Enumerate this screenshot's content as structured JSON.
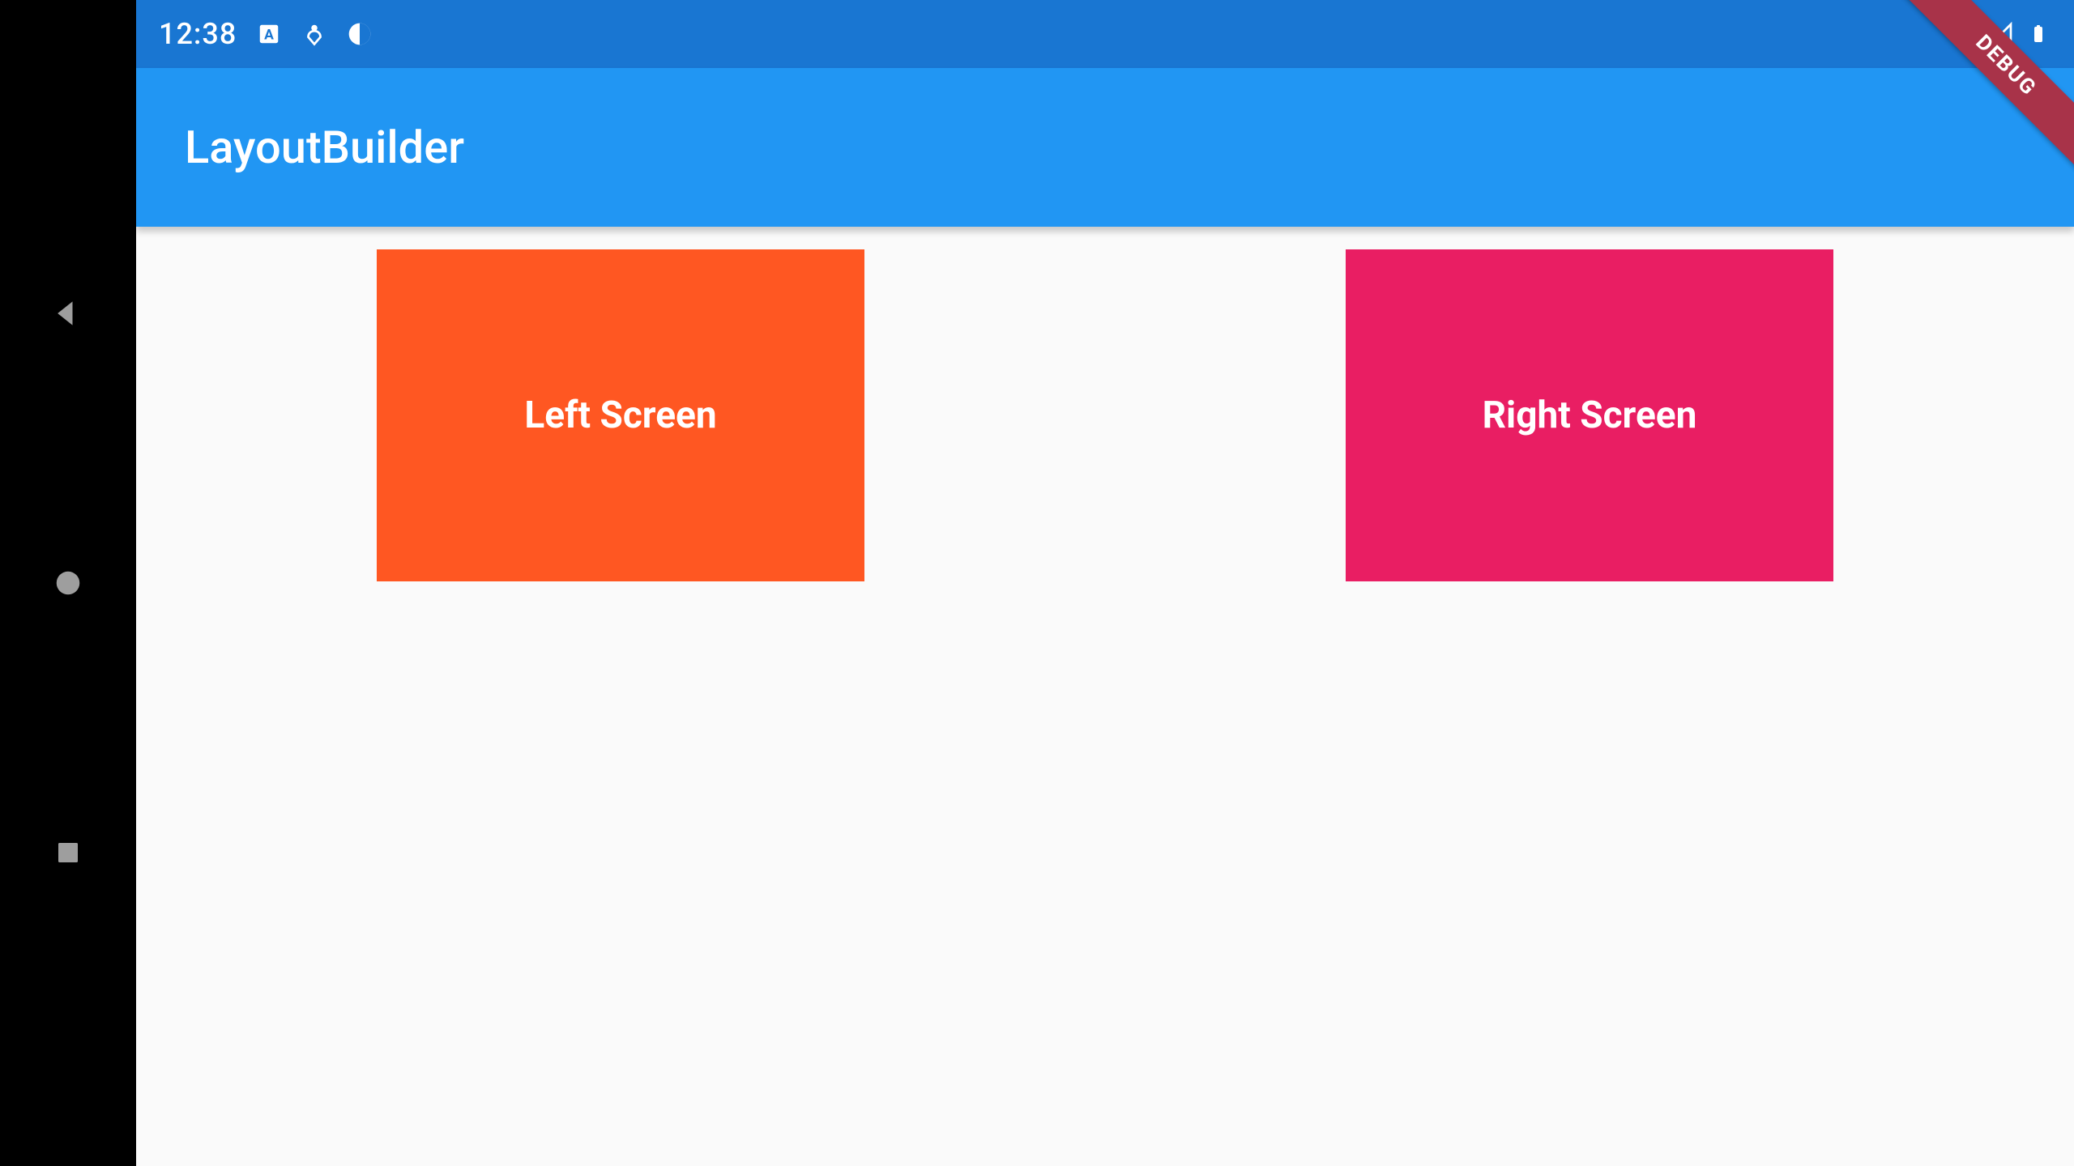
{
  "statusbar": {
    "time": "12:38",
    "icons_left": [
      "language-a-icon",
      "heart-icon",
      "contrast-icon"
    ],
    "icons_right": [
      "wifi-icon",
      "signal-icon",
      "battery-icon"
    ]
  },
  "appbar": {
    "title": "LayoutBuilder"
  },
  "body": {
    "left_card": {
      "label": "Left Screen",
      "color": "#ff5722"
    },
    "right_card": {
      "label": "Right Screen",
      "color": "#e91e63"
    }
  },
  "debug_banner": {
    "label": "DEBUG"
  },
  "navbar": {
    "buttons": [
      "back",
      "home",
      "recent"
    ]
  }
}
